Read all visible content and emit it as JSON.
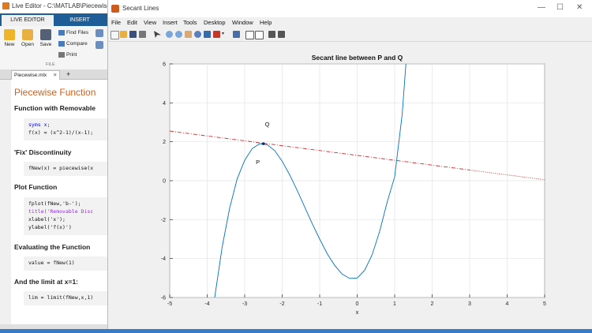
{
  "live_editor": {
    "title": "Live Editor - C:\\MATLAB\\Piecewise.mlx",
    "ribbon_tabs": [
      "LIVE EDITOR",
      "INSERT"
    ],
    "buttons": {
      "new": "New",
      "open": "Open",
      "save": "Save",
      "find_files": "Find Files",
      "compare": "Compare",
      "print": "Print"
    },
    "group_label": "FILE",
    "doc_tab": "Piecewise.mlx",
    "doc_tab_close": "✕",
    "doc_tab_add": "+",
    "sections": [
      {
        "heading": "Piecewise Function"
      },
      {
        "heading": "Function with Removable"
      },
      {
        "heading": "'Fix' Discontinuity"
      },
      {
        "heading": "Plot Function"
      },
      {
        "heading": "Evaluating the Function"
      },
      {
        "heading": "And the limit at x=1:"
      }
    ],
    "code": {
      "syms": "syms x;",
      "fdef": "f(x) = (x^2-1)/(x-1);",
      "fnew": "fNew(x) = piecewise(x",
      "fplot": "fplot(fNew,'b-');",
      "title": "title('Removable Disc",
      "xlabel": "xlabel('x');",
      "ylabel": "ylabel('f(x)')",
      "value": "value = fNew(1)",
      "lim": "lim = limit(fNew,x,1)"
    }
  },
  "figure": {
    "window_title": "Secant Lines",
    "window_controls": [
      "—",
      "☐",
      "✕"
    ],
    "menu": [
      "File",
      "Edit",
      "View",
      "Insert",
      "Tools",
      "Desktop",
      "Window",
      "Help"
    ]
  },
  "chart_data": {
    "type": "line",
    "title": "Secant line between P and Q",
    "xlabel": "x",
    "ylabel": "",
    "xlim": [
      -5,
      5
    ],
    "ylim": [
      -6,
      6
    ],
    "xticks": [
      -5,
      -4,
      -3,
      -2,
      -1,
      0,
      1,
      2,
      3,
      4,
      5
    ],
    "yticks": [
      -6,
      -4,
      -2,
      0,
      2,
      4,
      6
    ],
    "grid": true,
    "series": [
      {
        "style": "solid",
        "color": "#0072bd",
        "x": [
          -3.8,
          -3.6,
          -3.4,
          -3.2,
          -3.0,
          -2.8,
          -2.6,
          -2.4,
          -2.2,
          -2.0,
          -1.8,
          -1.6,
          -1.4,
          -1.2,
          -1.0,
          -0.8,
          -0.6,
          -0.4,
          -0.2,
          0.0,
          0.2,
          0.4,
          0.6,
          0.8,
          1.0,
          1.2,
          1.3
        ],
        "y": [
          -6.0,
          -3.4,
          -1.4,
          0.1,
          1.05,
          1.65,
          1.9,
          1.85,
          1.55,
          1.0,
          0.3,
          -0.5,
          -1.35,
          -2.2,
          -3.0,
          -3.75,
          -4.35,
          -4.8,
          -5.02,
          -5.0,
          -4.6,
          -3.8,
          -2.6,
          -1.1,
          0.2,
          3.4,
          6.0
        ]
      },
      {
        "style": "dashdot",
        "color": "#d62728",
        "x": [
          -5,
          3
        ],
        "y": [
          2.55,
          0.55
        ]
      },
      {
        "style": "dotted",
        "color": "#d62728",
        "x": [
          3,
          5
        ],
        "y": [
          0.55,
          0.05
        ]
      }
    ],
    "points": [
      {
        "x": -2.5,
        "y": 1.9,
        "color": "#0b2a6b"
      }
    ],
    "annotations": [
      {
        "text": "Q",
        "x": -2.4,
        "y": 2.8
      },
      {
        "text": "P",
        "x": -2.65,
        "y": 0.85
      }
    ]
  }
}
